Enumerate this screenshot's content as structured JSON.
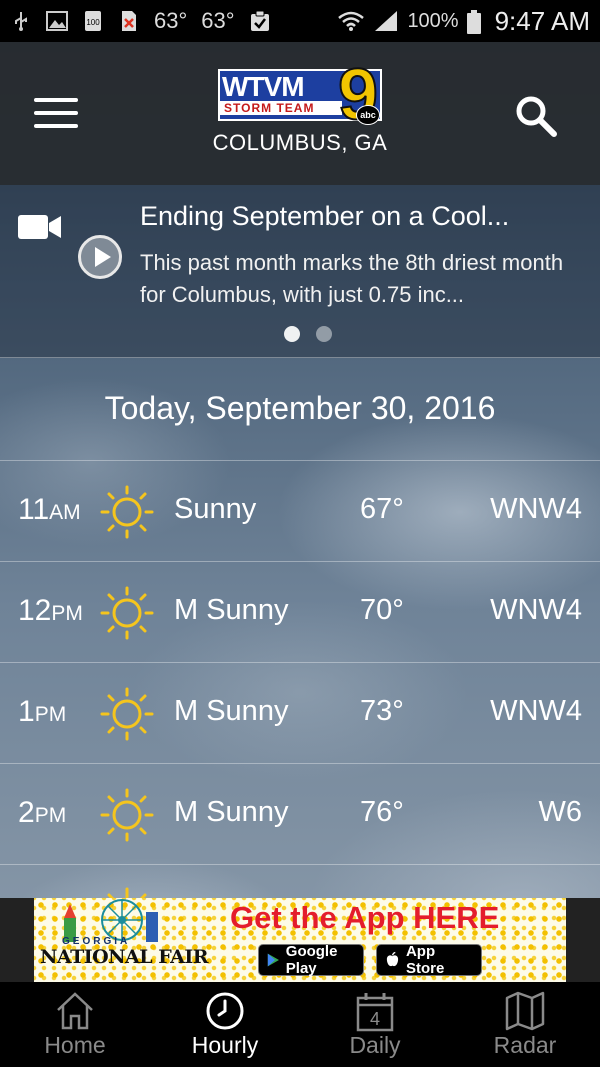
{
  "status_bar": {
    "temp1": "63°",
    "temp2": "63°",
    "battery_icon_text": "100",
    "battery_pct": "100%",
    "time": "9:47 AM"
  },
  "header": {
    "logo_letters": "WTVM",
    "logo_number": "9",
    "logo_tag": "STORM TEAM",
    "logo_network": "abc",
    "city": "COLUMBUS, GA"
  },
  "video": {
    "title": "Ending September on a Cool...",
    "body": "This past month marks the 8th driest month for Columbus, with just 0.75 inc...",
    "page_count": 2,
    "active_page": 0
  },
  "date_label": "Today, September 30, 2016",
  "hours": [
    {
      "hour": "11",
      "ampm": "AM",
      "condition": "Sunny",
      "temp": "67°",
      "wind": "WNW4",
      "icon": "sun-icon"
    },
    {
      "hour": "12",
      "ampm": "PM",
      "condition": "M Sunny",
      "temp": "70°",
      "wind": "WNW4",
      "icon": "sun-icon"
    },
    {
      "hour": "1",
      "ampm": "PM",
      "condition": "M Sunny",
      "temp": "73°",
      "wind": "WNW4",
      "icon": "sun-icon"
    },
    {
      "hour": "2",
      "ampm": "PM",
      "condition": "M Sunny",
      "temp": "76°",
      "wind": "W6",
      "icon": "sun-icon"
    }
  ],
  "ad": {
    "headline": "Get the App HERE",
    "brand_top": "GEORGIA",
    "brand_main": "NATIONAL FAIR",
    "google_play": "Google Play",
    "app_store": "App Store"
  },
  "nav": {
    "items": [
      {
        "label": "Home",
        "icon": "home-icon",
        "active": false
      },
      {
        "label": "Hourly",
        "icon": "clock-icon",
        "active": true
      },
      {
        "label": "Daily",
        "icon": "calendar-icon",
        "active": false,
        "badge": "4"
      },
      {
        "label": "Radar",
        "icon": "map-icon",
        "active": false
      }
    ]
  },
  "colors": {
    "sun": "#f5c51d",
    "header_bg": "#2b2e31",
    "nav_bg": "#000000",
    "ad_headline": "#e41d2c"
  }
}
